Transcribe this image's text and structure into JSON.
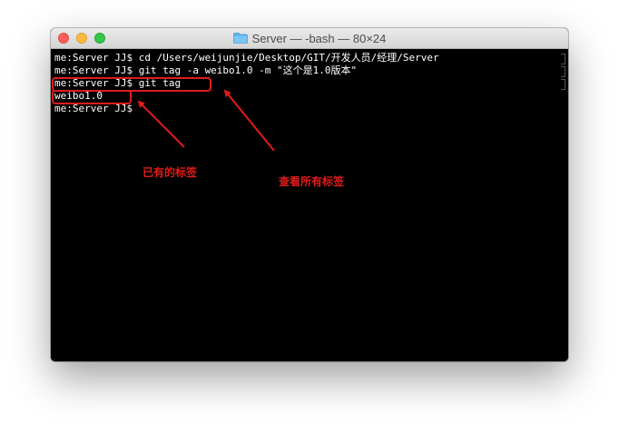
{
  "window": {
    "title": "Server — -bash — 80×24",
    "title_icon": "folder-icon"
  },
  "terminal": {
    "lines": [
      "me:Server JJ$ cd /Users/weijunjie/Desktop/GIT/开发人员/经理/Server",
      "me:Server JJ$ git tag -a weibo1.0 -m \"这个是1.0版本\"",
      "me:Server JJ$ git tag",
      "weibo1.0",
      "me:Server JJ$"
    ]
  },
  "annotations": {
    "existing_tag": "已有的标签",
    "view_all_tags": "查看所有标签"
  },
  "colors": {
    "annotation": "#e31a1a",
    "terminal_bg": "#000000",
    "terminal_fg": "#ffffff",
    "close": "#fc605c",
    "minimize": "#fdbc40",
    "zoom": "#34c84a"
  }
}
